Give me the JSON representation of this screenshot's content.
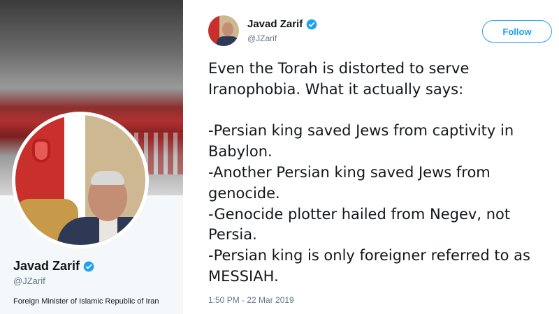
{
  "profile": {
    "name": "Javad Zarif",
    "handle": "@JZarif",
    "bio": "Foreign Minister of Islamic Republic of Iran"
  },
  "tweet": {
    "author_name": "Javad Zarif",
    "author_handle": "@JZarif",
    "follow_label": "Follow",
    "lines": [
      "Even the Torah is distorted to serve",
      "Iranophobia. What it actually says:",
      "",
      "-Persian king saved Jews from captivity in",
      "Babylon.",
      "-Another Persian king saved Jews from",
      "genocide.",
      "-Genocide plotter hailed from Negev, not",
      "Persia.",
      "-Persian king is only foreigner referred to as",
      "MESSIAH."
    ],
    "timestamp": "1:50 PM - 22 Mar 2019"
  },
  "colors": {
    "accent": "#1da1f2",
    "text": "#14171a",
    "muted": "#657786"
  },
  "icons": {
    "verified": "verified-badge-icon"
  }
}
